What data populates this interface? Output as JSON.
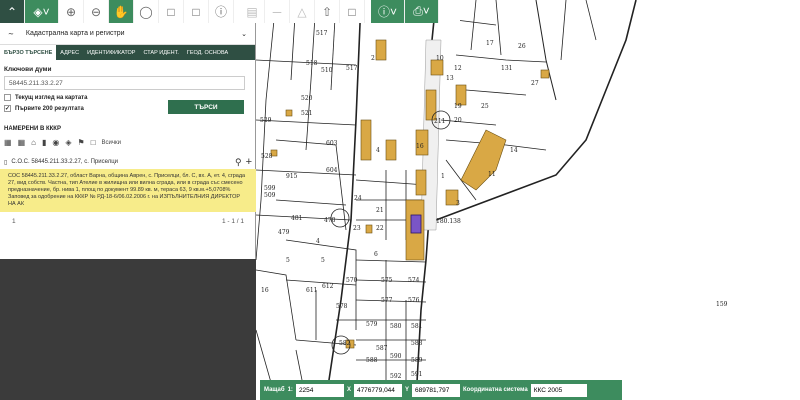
{
  "toolbar": {
    "items": [
      "chevron-up",
      "layers",
      "zoom-in",
      "zoom-out",
      "pan-hand",
      "globe",
      "add-point",
      "remove",
      "info",
      "print-region",
      "ruler",
      "polygon",
      "upload",
      "select-box",
      "info-circle",
      "print"
    ]
  },
  "panel": {
    "title": "Кадастрална карта и регистри",
    "tabs": [
      "БЪРЗО ТЪРСЕНЕ",
      "АДРЕС",
      "ИДЕНТИФИКАТОР",
      "СТАР ИДЕНТ.",
      "ГЕОД. ОСНОВА"
    ],
    "keywords_label": "Ключови думи",
    "search_value": "58445.211.33.2.27",
    "current_view_label": "Текущ изглед на картата",
    "first200_label": "Първите 200 резултата",
    "search_button": "ТЪРСИ",
    "found_title": "НАМЕРЕНИ В КККР",
    "all_label": "Всички",
    "result_title": "С.О.С. 58445.211.33.2.27, с. Приселци",
    "result_text": "СОС 58445.211.33.2.27, област Варна, община Аврен, с. Приселци, бл. С, вх. А, ет. 4, сграда 27, вид собств. Частна, тип Ателие в жилищна или вилна сграда, или в сграда със смесено предназначение, бр. нива 1, площ по документ 99.89 кв. м, тераса 63, 9 кв.м.+5,0708%",
    "result_text2": "Заповед за одобрение на КККР № РД-18-6/06.02.2006 г. на ИЗПЪЛНИТЕЛНИЯ ДИРЕКТОР НА АК",
    "pager_left": "1",
    "pager_right": "1 - 1 / 1"
  },
  "status": {
    "scale_label": "Мащаб",
    "scale_prefix": "1:",
    "scale_value": "2254",
    "x_label": "X",
    "x_value": "4776779,044",
    "y_label": "Y",
    "y_value": "689781,797",
    "crs_label": "Координатна система",
    "crs_value": "ККС 2005"
  },
  "map_labels": [
    "517",
    "518",
    "510",
    "520",
    "521",
    "517",
    "529",
    "528",
    "509",
    "599",
    "915",
    "604",
    "603",
    "2",
    "4",
    "16",
    "17",
    "26",
    "27",
    "25",
    "211",
    "131",
    "19",
    "20",
    "23",
    "21",
    "22",
    "24",
    "6",
    "5",
    "570",
    "575",
    "574",
    "577",
    "576",
    "4",
    "611",
    "612",
    "5",
    "578",
    "579",
    "580",
    "581",
    "583",
    "582",
    "588",
    "590",
    "589",
    "591",
    "592",
    "481",
    "479",
    "478",
    "477",
    "16",
    "159",
    "180.138",
    "10",
    "11",
    "14",
    "12",
    "13",
    "1",
    "3"
  ]
}
